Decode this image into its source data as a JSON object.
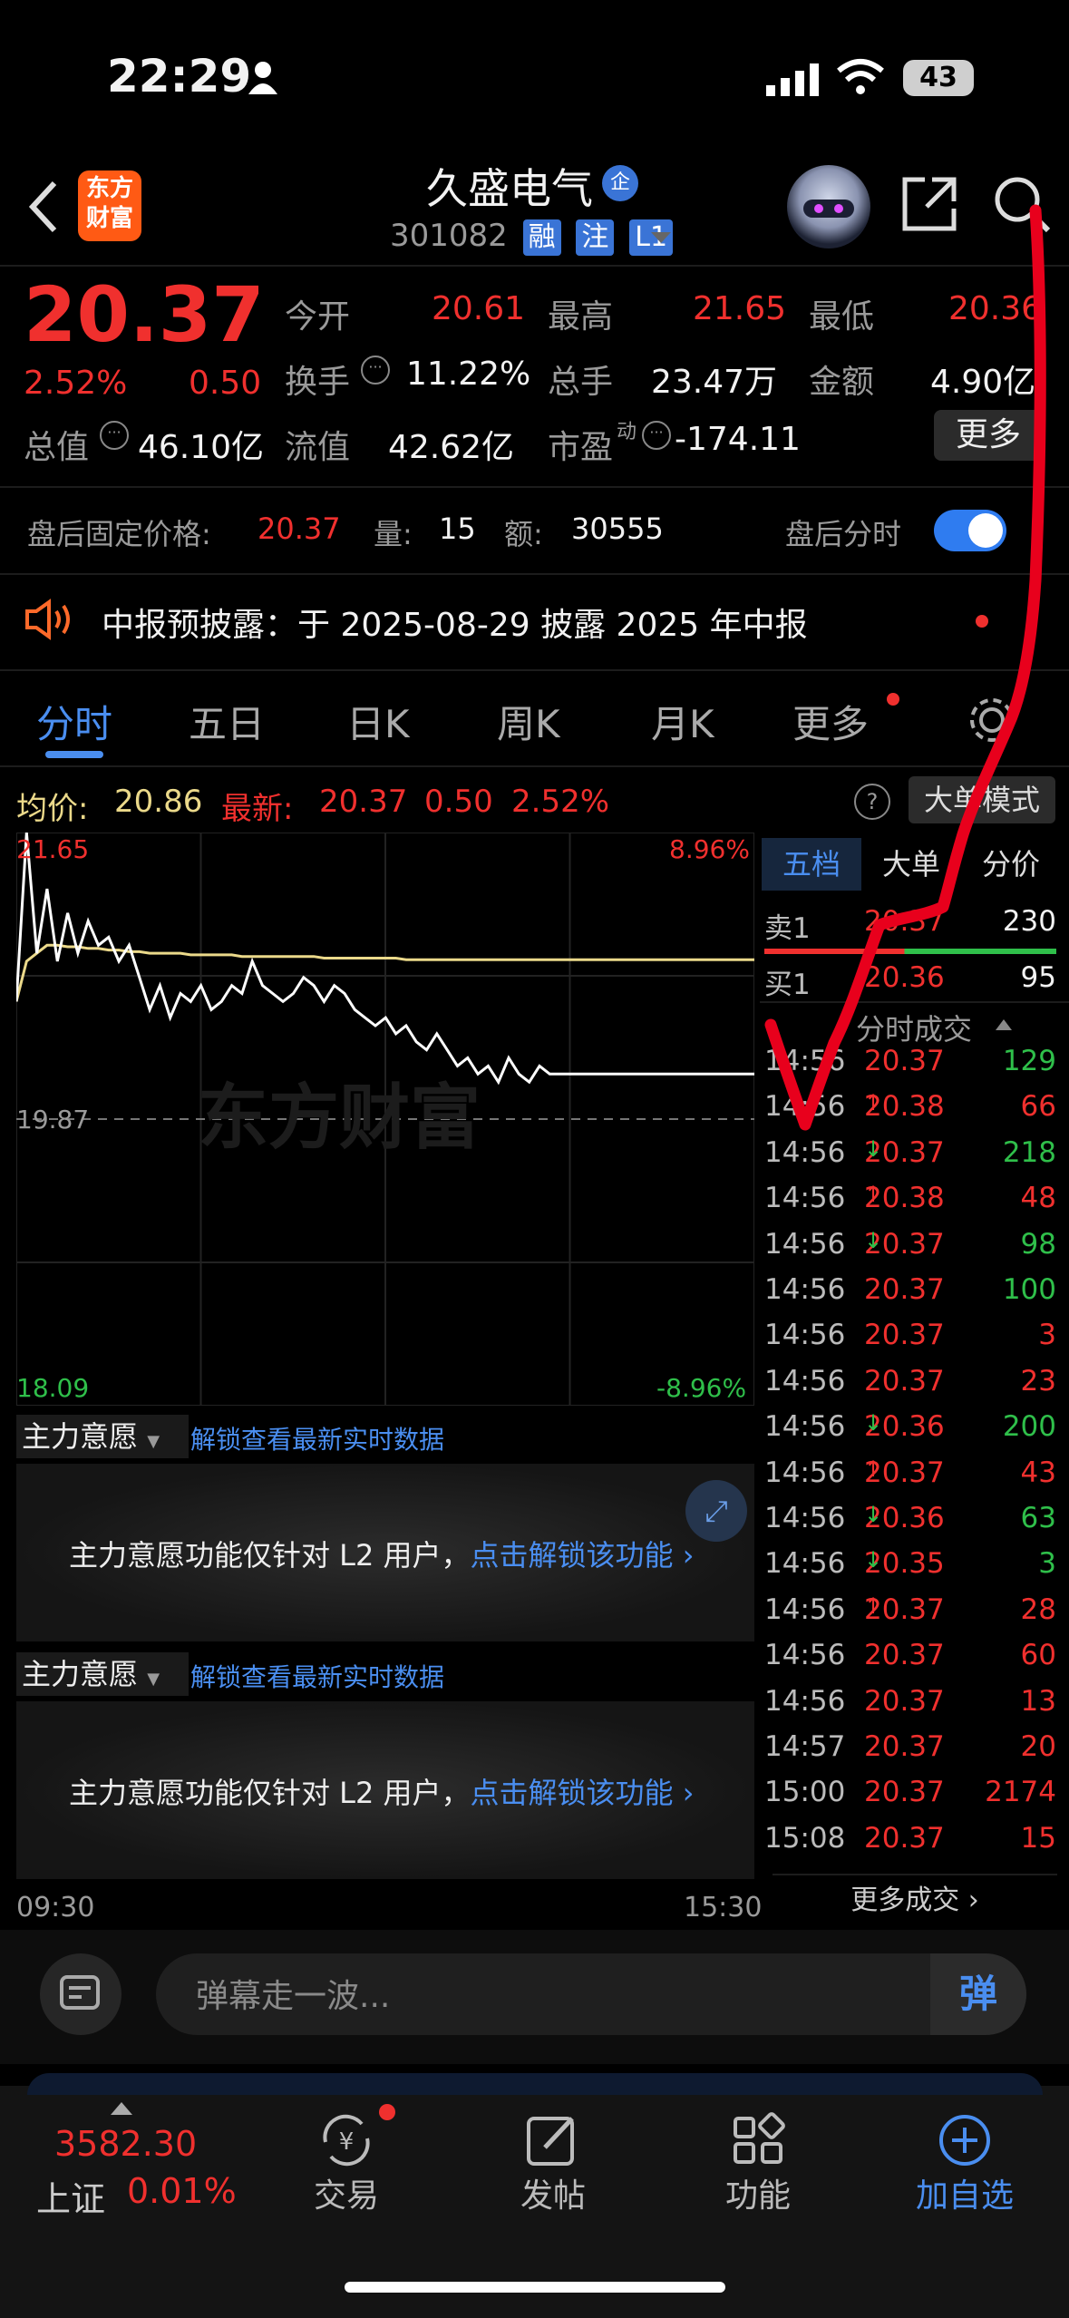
{
  "status_bar": {
    "time": "22:29",
    "battery": "43"
  },
  "header": {
    "logo_line1": "东方",
    "logo_line2": "财富",
    "stock_name": "久盛电气",
    "corp_badge": "企",
    "stock_code": "301082",
    "tags": [
      "融",
      "注",
      "L1"
    ]
  },
  "quote": {
    "price": "20.37",
    "change_pct": "2.52%",
    "change_abs": "0.50",
    "open_label": "今开",
    "open": "20.61",
    "high_label": "最高",
    "high": "21.65",
    "low_label": "最低",
    "low": "20.36",
    "turnover_label": "换手",
    "turnover": "11.22%",
    "volume_label": "总手",
    "volume": "23.47万",
    "amount_label": "金额",
    "amount": "4.90亿",
    "mktcap_label": "总值",
    "mktcap": "46.10亿",
    "float_label": "流值",
    "float": "42.62亿",
    "pe_label": "市盈",
    "pe_sup": "动",
    "pe": "-174.11",
    "more_label": "更多"
  },
  "after_hours": {
    "label": "盘后固定价格:",
    "price": "20.37",
    "vol_label": "量:",
    "vol": "15",
    "amt_label": "额:",
    "amt": "30555",
    "toggle_label": "盘后分时",
    "toggle_on": true
  },
  "notice": {
    "text": "中报预披露：于 2025-08-29 披露 2025 年中报"
  },
  "tabs": [
    "分时",
    "五日",
    "日K",
    "周K",
    "月K",
    "更多"
  ],
  "chart_header": {
    "avg_label": "均价:",
    "avg": "20.86",
    "latest_label": "最新:",
    "latest": "20.37",
    "latest_change": "0.50",
    "latest_pct": "2.52%",
    "mode_button": "大单模式"
  },
  "chart_data": {
    "type": "line",
    "title": "",
    "x_start": "09:30",
    "x_end": "15:30",
    "y_max_label": "21.65",
    "y_mid_label": "19.87",
    "y_min_label": "18.09",
    "pct_max_label": "8.96%",
    "pct_min_label": "-8.96%",
    "ylim": [
      18.09,
      21.65
    ],
    "prev_close": 19.87,
    "series": [
      {
        "name": "最新",
        "values": [
          20.6,
          21.65,
          20.9,
          21.3,
          20.85,
          21.15,
          20.9,
          21.1,
          20.95,
          21.0,
          20.85,
          20.95,
          20.75,
          20.55,
          20.7,
          20.5,
          20.65,
          20.6,
          20.7,
          20.55,
          20.6,
          20.7,
          20.65,
          20.85,
          20.7,
          20.65,
          20.6,
          20.65,
          20.75,
          20.7,
          20.6,
          20.7,
          20.65,
          20.55,
          20.5,
          20.45,
          20.5,
          20.4,
          20.45,
          20.35,
          20.3,
          20.4,
          20.3,
          20.2,
          20.25,
          20.15,
          20.2,
          20.1,
          20.25,
          20.15,
          20.1,
          20.2,
          20.15,
          20.15,
          20.15,
          20.15,
          20.15,
          20.15,
          20.15,
          20.15
        ]
      },
      {
        "name": "均价",
        "values": [
          20.6,
          20.85,
          20.9,
          20.95,
          20.95,
          20.94,
          20.94,
          20.93,
          20.93,
          20.92,
          20.92,
          20.91,
          20.91,
          20.9,
          20.9,
          20.9,
          20.9,
          20.89,
          20.89,
          20.89,
          20.89,
          20.89,
          20.88,
          20.88,
          20.88,
          20.88,
          20.88,
          20.88,
          20.88,
          20.88,
          20.87,
          20.87,
          20.87,
          20.87,
          20.87,
          20.87,
          20.87,
          20.87,
          20.86,
          20.86,
          20.86,
          20.86,
          20.86,
          20.86,
          20.86,
          20.86,
          20.86,
          20.86,
          20.86,
          20.86,
          20.86,
          20.86,
          20.86,
          20.86,
          20.86,
          20.86,
          20.86,
          20.86,
          20.86,
          20.86
        ]
      }
    ],
    "watermark": "东方财富"
  },
  "order_book": {
    "tabs": [
      "五档",
      "大单",
      "分价"
    ],
    "sell1_label": "卖1",
    "sell1_price": "20.37",
    "sell1_vol": "230",
    "buy1_label": "买1",
    "buy1_price": "20.36",
    "buy1_vol": "95",
    "ticks_header": "分时成交",
    "ticks": [
      {
        "time": "14:56",
        "price": "20.37",
        "arrow": "",
        "vol": "129",
        "vol_color": "green"
      },
      {
        "time": "14:56",
        "price": "20.38",
        "arrow": "↑",
        "vol": "66",
        "vol_color": "red"
      },
      {
        "time": "14:56",
        "price": "20.37",
        "arrow": "↓",
        "vol": "218",
        "vol_color": "green"
      },
      {
        "time": "14:56",
        "price": "20.38",
        "arrow": "↑",
        "vol": "48",
        "vol_color": "red"
      },
      {
        "time": "14:56",
        "price": "20.37",
        "arrow": "↓",
        "vol": "98",
        "vol_color": "green"
      },
      {
        "time": "14:56",
        "price": "20.37",
        "arrow": "",
        "vol": "100",
        "vol_color": "green"
      },
      {
        "time": "14:56",
        "price": "20.37",
        "arrow": "",
        "vol": "3",
        "vol_color": "red"
      },
      {
        "time": "14:56",
        "price": "20.37",
        "arrow": "",
        "vol": "23",
        "vol_color": "red"
      },
      {
        "time": "14:56",
        "price": "20.36",
        "arrow": "↓",
        "vol": "200",
        "vol_color": "green"
      },
      {
        "time": "14:56",
        "price": "20.37",
        "arrow": "↑",
        "vol": "43",
        "vol_color": "red"
      },
      {
        "time": "14:56",
        "price": "20.36",
        "arrow": "↓",
        "vol": "63",
        "vol_color": "green"
      },
      {
        "time": "14:56",
        "price": "20.35",
        "arrow": "↓",
        "vol": "3",
        "vol_color": "green"
      },
      {
        "time": "14:56",
        "price": "20.37",
        "arrow": "↑",
        "vol": "28",
        "vol_color": "red"
      },
      {
        "time": "14:56",
        "price": "20.37",
        "arrow": "",
        "vol": "60",
        "vol_color": "red"
      },
      {
        "time": "14:56",
        "price": "20.37",
        "arrow": "",
        "vol": "13",
        "vol_color": "red"
      },
      {
        "time": "14:57",
        "price": "20.37",
        "arrow": "",
        "vol": "20",
        "vol_color": "red"
      },
      {
        "time": "15:00",
        "price": "20.37",
        "arrow": "",
        "vol": "2174",
        "vol_color": "red"
      },
      {
        "time": "15:08",
        "price": "20.37",
        "arrow": "",
        "vol": "15",
        "vol_color": "red"
      }
    ],
    "more_ticks": "更多成交"
  },
  "panels": [
    {
      "select": "主力意愿",
      "link": "解锁查看最新实时数据",
      "message": "主力意愿功能仅针对 L2 用户，",
      "cta": "点击解锁该功能"
    },
    {
      "select": "主力意愿",
      "link": "解锁查看最新实时数据",
      "message": "主力意愿功能仅针对 L2 用户，",
      "cta": "点击解锁该功能"
    }
  ],
  "comment_bar": {
    "placeholder": "弹幕走一波...",
    "danmu_label": "弹"
  },
  "bottom_nav": {
    "index_value": "3582.30",
    "index_name": "上证",
    "index_pct": "0.01%",
    "trade": "交易",
    "post": "发帖",
    "func": "功能",
    "add": "加自选"
  },
  "colors": {
    "up": "#f0302e",
    "down": "#2fbf4a",
    "accent": "#4a8ef0",
    "avg_line": "#ebd98a",
    "annotation": "#e8001c"
  }
}
